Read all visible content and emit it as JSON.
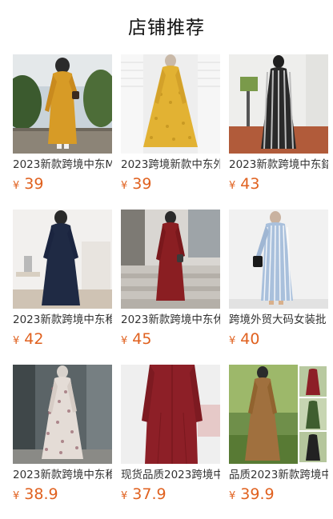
{
  "section": {
    "title": "店铺推荐"
  },
  "currency_symbol": "¥",
  "products": [
    {
      "name": "2023新款跨境中东M",
      "price": "39",
      "image": "mustard-abaya-outdoor"
    },
    {
      "name": "2023跨境新款中东外",
      "price": "39",
      "image": "yellow-floral-dress"
    },
    {
      "name": "2023新款跨境中东錔",
      "price": "43",
      "image": "black-striped-abaya"
    },
    {
      "name": "2023新款跨境中东稚",
      "price": "42",
      "image": "navy-abaya-indoor"
    },
    {
      "name": "2023新款跨境中东休",
      "price": "45",
      "image": "maroon-abaya-steps"
    },
    {
      "name": "跨境外贸大码女装批",
      "price": "40",
      "image": "blue-striped-shirt-dress"
    },
    {
      "name": "2023新款跨境中东稚",
      "price": "38.9",
      "image": "floral-print-abaya"
    },
    {
      "name": "现货品质2023跨境中",
      "price": "37.9",
      "image": "burgundy-abaya-closeup"
    },
    {
      "name": "品质2023新款跨境中",
      "price": "39.9",
      "image": "brown-abaya-color-options"
    }
  ]
}
